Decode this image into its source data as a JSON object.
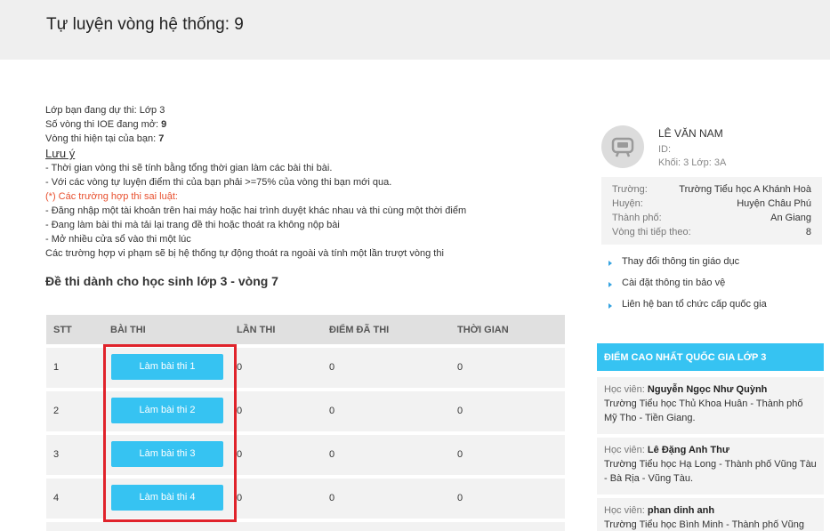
{
  "page": {
    "title": "Tự luyện vòng hệ thống: 9"
  },
  "info": {
    "grade_label": "Lớp bạn đang dự thi: ",
    "grade_value": "Lớp 3",
    "open_rounds_label": "Số vòng thi IOE đang mở: ",
    "open_rounds_value": "9",
    "current_round_label": "Vòng thi hiện tại của bạn: ",
    "current_round_value": "7",
    "note_title": "Lưu ý",
    "note_1": "- Thời gian vòng thi sẽ tính bằng tổng thời gian làm các bài thi bài.",
    "note_2": "- Với các vòng tự luyện điểm thi của bạn phải >=75% của vòng thi bạn mới qua.",
    "violation_title": "(*) Các trường hợp thi sai luật:",
    "violation_1": "- Đăng nhập một tài khoản trên hai máy hoặc hai trình duyệt khác nhau và thi cùng một thời điểm",
    "violation_2": "- Đang làm bài thi mà tải lại trang đề thi hoặc thoát ra không nộp bài",
    "violation_3": "- Mở nhiều cửa sổ vào thi một lúc",
    "violation_4": "Các trường hợp vi phạm sẽ bị hệ thống tự động thoát ra ngoài và tính một lần trượt vòng thi"
  },
  "exam": {
    "section_title": "Đề thi dành cho học sinh lớp 3 - vòng 7",
    "headers": {
      "stt": "STT",
      "test": "BÀI THI",
      "attempts": "LẦN THI",
      "score": "ĐIỂM ĐÃ THI",
      "time": "THỜI GIAN"
    },
    "rows": [
      {
        "stt": "1",
        "button": "Làm bài thi 1",
        "attempts": "0",
        "score": "0",
        "time": "0"
      },
      {
        "stt": "2",
        "button": "Làm bài thi 2",
        "attempts": "0",
        "score": "0",
        "time": "0"
      },
      {
        "stt": "3",
        "button": "Làm bài thi 3",
        "attempts": "0",
        "score": "0",
        "time": "0"
      },
      {
        "stt": "4",
        "button": "Làm bài thi 4",
        "attempts": "0",
        "score": "0",
        "time": "0"
      }
    ]
  },
  "profile": {
    "name": "LÊ VĂN NAM",
    "id_label": "ID:",
    "class_text": "Khối: 3 Lớp: 3A",
    "school_label": "Trường:",
    "school": "Trường Tiểu học A Khánh Hoà",
    "district_label": "Huyện:",
    "district": "Huyện Châu Phú",
    "city_label": "Thành phố:",
    "city": "An Giang",
    "next_round_label": "Vòng thi tiếp theo:",
    "next_round": "8"
  },
  "links": [
    "Thay đổi thông tin giáo dục",
    "Cài đặt thông tin bảo vệ",
    "Liên hệ ban tổ chức cấp quốc gia"
  ],
  "highscores": {
    "title": "ĐIỂM CAO NHẤT QUỐC GIA LỚP 3",
    "student_label": "Học viên: ",
    "items": [
      {
        "name": "Nguyễn Ngọc Như Quỳnh",
        "school": "Trường Tiểu học Thủ Khoa Huân - Thành phố Mỹ Tho - Tiền Giang."
      },
      {
        "name": "Lê Đặng Anh Thư",
        "school": "Trường Tiểu học Hạ Long - Thành phố Vũng Tàu - Bà Rịa - Vũng Tàu."
      },
      {
        "name": "phan dinh anh",
        "school": "Trường Tiểu học Bình Minh - Thành phố Vũng"
      }
    ]
  },
  "colors": {
    "accent": "#36c3f2",
    "highlight": "#e0232b",
    "warning": "#e8502f"
  }
}
